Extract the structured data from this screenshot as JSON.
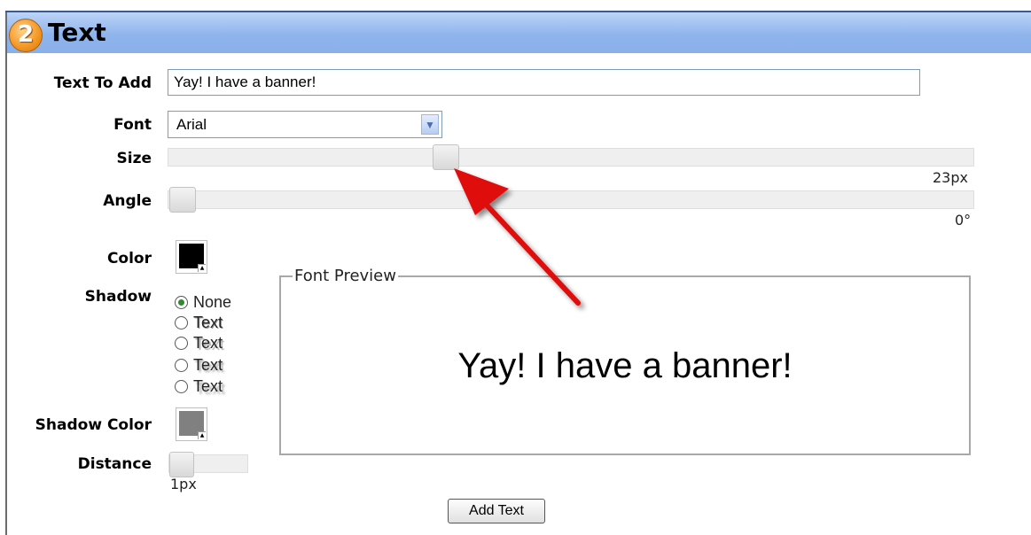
{
  "panel": {
    "step_number": "2",
    "title": "Text"
  },
  "text_to_add": {
    "label": "Text To Add",
    "value": "Yay! I have a banner!"
  },
  "font": {
    "label": "Font",
    "selected": "Arial"
  },
  "size": {
    "label": "Size",
    "value_text": "23px",
    "fraction": 0.34
  },
  "angle": {
    "label": "Angle",
    "value_text": "0°",
    "fraction": 0.0
  },
  "color": {
    "label": "Color",
    "swatch": "#000000"
  },
  "shadow": {
    "label": "Shadow",
    "options": [
      {
        "label": "None",
        "checked": true
      },
      {
        "label": "Text",
        "checked": false
      },
      {
        "label": "Text",
        "checked": false
      },
      {
        "label": "Text",
        "checked": false
      },
      {
        "label": "Text",
        "checked": false
      }
    ]
  },
  "shadow_color": {
    "label": "Shadow Color",
    "swatch": "#808080"
  },
  "distance": {
    "label": "Distance",
    "value_text": "1px",
    "fraction": 0.0
  },
  "preview": {
    "legend": "Font Preview",
    "text": "Yay!  I have a banner!"
  },
  "actions": {
    "add_text": "Add Text"
  },
  "icons": {
    "dropdown": "chevron-down-icon",
    "annotation": "red-arrow-icon"
  },
  "colors": {
    "header": "#8fb4ec",
    "badge": "#f39a28",
    "annotation_arrow": "#e01010"
  }
}
